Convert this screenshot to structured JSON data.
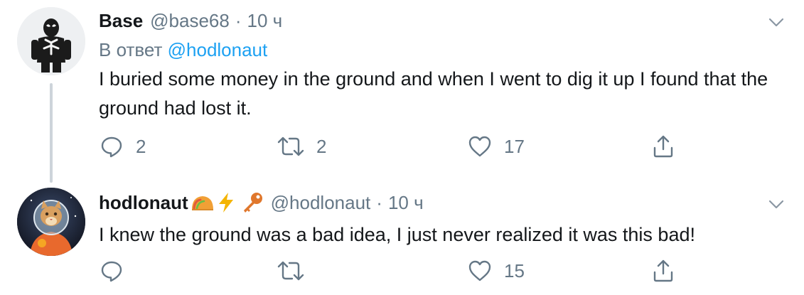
{
  "tweets": [
    {
      "author_name": "Base",
      "handle": "@base68",
      "separator": "·",
      "time": "10 ч",
      "reply_prefix": "В ответ",
      "reply_mention": "@hodlonaut",
      "text": "I buried some money in the ground and when I went to dig it up I found that the ground had lost it.",
      "actions": {
        "reply_count": "2",
        "retweet_count": "2",
        "like_count": "17"
      },
      "icons": [
        "reply-icon",
        "retweet-icon",
        "like-icon",
        "share-icon",
        "chevron-down-icon"
      ]
    },
    {
      "author_name": "hodlonaut",
      "name_emojis": [
        "taco-emoji",
        "lightning-emoji",
        "key-emoji"
      ],
      "handle": "@hodlonaut",
      "separator": "·",
      "time": "10 ч",
      "text": "I knew the ground was a bad idea, I just never realized it was this bad!",
      "actions": {
        "reply_count": "",
        "retweet_count": "",
        "like_count": "15"
      },
      "icons": [
        "reply-icon",
        "retweet-icon",
        "like-icon",
        "share-icon",
        "chevron-down-icon"
      ]
    }
  ],
  "colors": {
    "text_primary": "#14171a",
    "text_secondary": "#657786",
    "link": "#1da1f2",
    "thread_line": "#cdd4da",
    "lightning": "#f4b400",
    "key": "#e0772c",
    "taco": "#f1a035"
  }
}
